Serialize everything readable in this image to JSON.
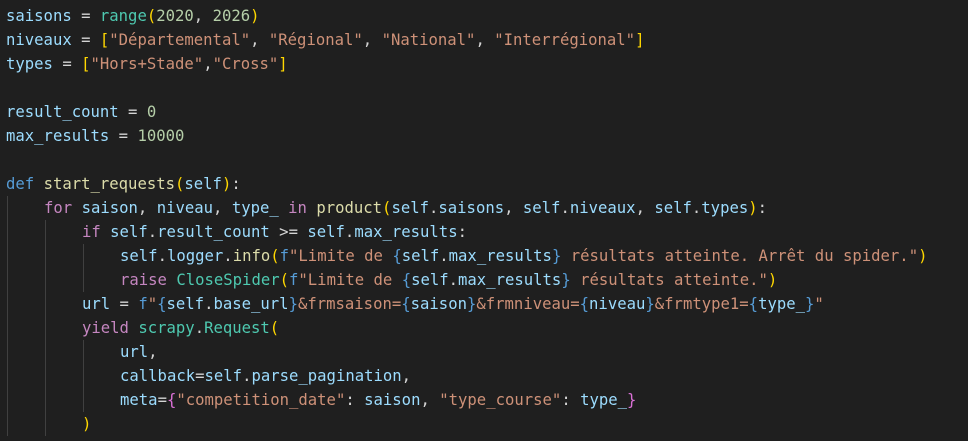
{
  "editor": {
    "colors": {
      "background": "#1f1f1f",
      "variable": "#9cdcfe",
      "keyword_control": "#c586c0",
      "keyword_def": "#569cd6",
      "function": "#dcdcaa",
      "class": "#4ec9b0",
      "string": "#ce9178",
      "number": "#b5cea8",
      "operator": "#d4d4d4",
      "bracket_gold": "#ffd700",
      "bracket_purple": "#da70d6",
      "bracket_blue": "#179fff",
      "indent_guide": "#404040"
    },
    "lines": [
      {
        "indent": 0,
        "tokens": [
          {
            "t": "saisons",
            "c": "variable"
          },
          {
            "t": " = ",
            "c": "operator"
          },
          {
            "t": "range",
            "c": "class"
          },
          {
            "t": "(",
            "c": "bracket_gold"
          },
          {
            "t": "2020",
            "c": "number"
          },
          {
            "t": ", ",
            "c": "operator"
          },
          {
            "t": "2026",
            "c": "number"
          },
          {
            "t": ")",
            "c": "bracket_gold"
          }
        ]
      },
      {
        "indent": 0,
        "tokens": [
          {
            "t": "niveaux",
            "c": "variable"
          },
          {
            "t": " = ",
            "c": "operator"
          },
          {
            "t": "[",
            "c": "bracket_gold"
          },
          {
            "t": "\"Départemental\"",
            "c": "string"
          },
          {
            "t": ", ",
            "c": "operator"
          },
          {
            "t": "\"Régional\"",
            "c": "string"
          },
          {
            "t": ", ",
            "c": "operator"
          },
          {
            "t": "\"National\"",
            "c": "string"
          },
          {
            "t": ", ",
            "c": "operator"
          },
          {
            "t": "\"Interrégional\"",
            "c": "string"
          },
          {
            "t": "]",
            "c": "bracket_gold"
          }
        ]
      },
      {
        "indent": 0,
        "tokens": [
          {
            "t": "types",
            "c": "variable"
          },
          {
            "t": " = ",
            "c": "operator"
          },
          {
            "t": "[",
            "c": "bracket_gold"
          },
          {
            "t": "\"Hors+Stade\"",
            "c": "string"
          },
          {
            "t": ",",
            "c": "operator"
          },
          {
            "t": "\"Cross\"",
            "c": "string"
          },
          {
            "t": "]",
            "c": "bracket_gold"
          }
        ]
      },
      {
        "indent": 0,
        "tokens": []
      },
      {
        "indent": 0,
        "tokens": [
          {
            "t": "result_count",
            "c": "variable"
          },
          {
            "t": " = ",
            "c": "operator"
          },
          {
            "t": "0",
            "c": "number"
          }
        ]
      },
      {
        "indent": 0,
        "tokens": [
          {
            "t": "max_results",
            "c": "variable"
          },
          {
            "t": " = ",
            "c": "operator"
          },
          {
            "t": "10000",
            "c": "number"
          }
        ]
      },
      {
        "indent": 0,
        "tokens": []
      },
      {
        "indent": 0,
        "tokens": [
          {
            "t": "def",
            "c": "keyword_def"
          },
          {
            "t": " ",
            "c": "operator"
          },
          {
            "t": "start_requests",
            "c": "function"
          },
          {
            "t": "(",
            "c": "bracket_gold"
          },
          {
            "t": "self",
            "c": "variable"
          },
          {
            "t": ")",
            "c": "bracket_gold"
          },
          {
            "t": ":",
            "c": "operator"
          }
        ]
      },
      {
        "indent": 1,
        "tokens": [
          {
            "t": "for",
            "c": "keyword_control"
          },
          {
            "t": " ",
            "c": "operator"
          },
          {
            "t": "saison",
            "c": "variable"
          },
          {
            "t": ", ",
            "c": "operator"
          },
          {
            "t": "niveau",
            "c": "variable"
          },
          {
            "t": ", ",
            "c": "operator"
          },
          {
            "t": "type_",
            "c": "variable"
          },
          {
            "t": " ",
            "c": "operator"
          },
          {
            "t": "in",
            "c": "keyword_control"
          },
          {
            "t": " ",
            "c": "operator"
          },
          {
            "t": "product",
            "c": "function"
          },
          {
            "t": "(",
            "c": "bracket_gold"
          },
          {
            "t": "self",
            "c": "variable"
          },
          {
            "t": ".",
            "c": "operator"
          },
          {
            "t": "saisons",
            "c": "variable"
          },
          {
            "t": ", ",
            "c": "operator"
          },
          {
            "t": "self",
            "c": "variable"
          },
          {
            "t": ".",
            "c": "operator"
          },
          {
            "t": "niveaux",
            "c": "variable"
          },
          {
            "t": ", ",
            "c": "operator"
          },
          {
            "t": "self",
            "c": "variable"
          },
          {
            "t": ".",
            "c": "operator"
          },
          {
            "t": "types",
            "c": "variable"
          },
          {
            "t": ")",
            "c": "bracket_gold"
          },
          {
            "t": ":",
            "c": "operator"
          }
        ]
      },
      {
        "indent": 2,
        "tokens": [
          {
            "t": "if",
            "c": "keyword_control"
          },
          {
            "t": " ",
            "c": "operator"
          },
          {
            "t": "self",
            "c": "variable"
          },
          {
            "t": ".",
            "c": "operator"
          },
          {
            "t": "result_count",
            "c": "variable"
          },
          {
            "t": " >= ",
            "c": "operator"
          },
          {
            "t": "self",
            "c": "variable"
          },
          {
            "t": ".",
            "c": "operator"
          },
          {
            "t": "max_results",
            "c": "variable"
          },
          {
            "t": ":",
            "c": "operator"
          }
        ]
      },
      {
        "indent": 3,
        "tokens": [
          {
            "t": "self",
            "c": "variable"
          },
          {
            "t": ".",
            "c": "operator"
          },
          {
            "t": "logger",
            "c": "variable"
          },
          {
            "t": ".",
            "c": "operator"
          },
          {
            "t": "info",
            "c": "function"
          },
          {
            "t": "(",
            "c": "bracket_gold"
          },
          {
            "t": "f",
            "c": "keyword_def"
          },
          {
            "t": "\"Limite de ",
            "c": "string"
          },
          {
            "t": "{",
            "c": "keyword_def"
          },
          {
            "t": "self",
            "c": "variable"
          },
          {
            "t": ".",
            "c": "operator"
          },
          {
            "t": "max_results",
            "c": "variable"
          },
          {
            "t": "}",
            "c": "keyword_def"
          },
          {
            "t": " résultats atteinte. Arrêt du spider.\"",
            "c": "string"
          },
          {
            "t": ")",
            "c": "bracket_gold"
          }
        ]
      },
      {
        "indent": 3,
        "tokens": [
          {
            "t": "raise",
            "c": "keyword_control"
          },
          {
            "t": " ",
            "c": "operator"
          },
          {
            "t": "CloseSpider",
            "c": "class"
          },
          {
            "t": "(",
            "c": "bracket_gold"
          },
          {
            "t": "f",
            "c": "keyword_def"
          },
          {
            "t": "\"Limite de ",
            "c": "string"
          },
          {
            "t": "{",
            "c": "keyword_def"
          },
          {
            "t": "self",
            "c": "variable"
          },
          {
            "t": ".",
            "c": "operator"
          },
          {
            "t": "max_results",
            "c": "variable"
          },
          {
            "t": "}",
            "c": "keyword_def"
          },
          {
            "t": " résultats atteinte.\"",
            "c": "string"
          },
          {
            "t": ")",
            "c": "bracket_gold"
          }
        ]
      },
      {
        "indent": 2,
        "tokens": [
          {
            "t": "url",
            "c": "variable"
          },
          {
            "t": " = ",
            "c": "operator"
          },
          {
            "t": "f",
            "c": "keyword_def"
          },
          {
            "t": "\"",
            "c": "string"
          },
          {
            "t": "{",
            "c": "keyword_def"
          },
          {
            "t": "self",
            "c": "variable"
          },
          {
            "t": ".",
            "c": "operator"
          },
          {
            "t": "base_url",
            "c": "variable"
          },
          {
            "t": "}",
            "c": "keyword_def"
          },
          {
            "t": "&frmsaison=",
            "c": "string"
          },
          {
            "t": "{",
            "c": "keyword_def"
          },
          {
            "t": "saison",
            "c": "variable"
          },
          {
            "t": "}",
            "c": "keyword_def"
          },
          {
            "t": "&frmniveau=",
            "c": "string"
          },
          {
            "t": "{",
            "c": "keyword_def"
          },
          {
            "t": "niveau",
            "c": "variable"
          },
          {
            "t": "}",
            "c": "keyword_def"
          },
          {
            "t": "&frmtype1=",
            "c": "string"
          },
          {
            "t": "{",
            "c": "keyword_def"
          },
          {
            "t": "type_",
            "c": "variable"
          },
          {
            "t": "}",
            "c": "keyword_def"
          },
          {
            "t": "\"",
            "c": "string"
          }
        ]
      },
      {
        "indent": 2,
        "tokens": [
          {
            "t": "yield",
            "c": "keyword_control"
          },
          {
            "t": " ",
            "c": "operator"
          },
          {
            "t": "scrapy",
            "c": "class"
          },
          {
            "t": ".",
            "c": "operator"
          },
          {
            "t": "Request",
            "c": "class"
          },
          {
            "t": "(",
            "c": "bracket_gold"
          }
        ]
      },
      {
        "indent": 3,
        "tokens": [
          {
            "t": "url",
            "c": "variable"
          },
          {
            "t": ",",
            "c": "operator"
          }
        ]
      },
      {
        "indent": 3,
        "tokens": [
          {
            "t": "callback",
            "c": "variable"
          },
          {
            "t": "=",
            "c": "operator"
          },
          {
            "t": "self",
            "c": "variable"
          },
          {
            "t": ".",
            "c": "operator"
          },
          {
            "t": "parse_pagination",
            "c": "variable"
          },
          {
            "t": ",",
            "c": "operator"
          }
        ]
      },
      {
        "indent": 3,
        "tokens": [
          {
            "t": "meta",
            "c": "variable"
          },
          {
            "t": "=",
            "c": "operator"
          },
          {
            "t": "{",
            "c": "bracket_purple"
          },
          {
            "t": "\"competition_date\"",
            "c": "string"
          },
          {
            "t": ": ",
            "c": "operator"
          },
          {
            "t": "saison",
            "c": "variable"
          },
          {
            "t": ", ",
            "c": "operator"
          },
          {
            "t": "\"type_course\"",
            "c": "string"
          },
          {
            "t": ": ",
            "c": "operator"
          },
          {
            "t": "type_",
            "c": "variable"
          },
          {
            "t": "}",
            "c": "bracket_purple"
          }
        ]
      },
      {
        "indent": 2,
        "tokens": [
          {
            "t": ")",
            "c": "bracket_gold"
          }
        ]
      }
    ]
  }
}
